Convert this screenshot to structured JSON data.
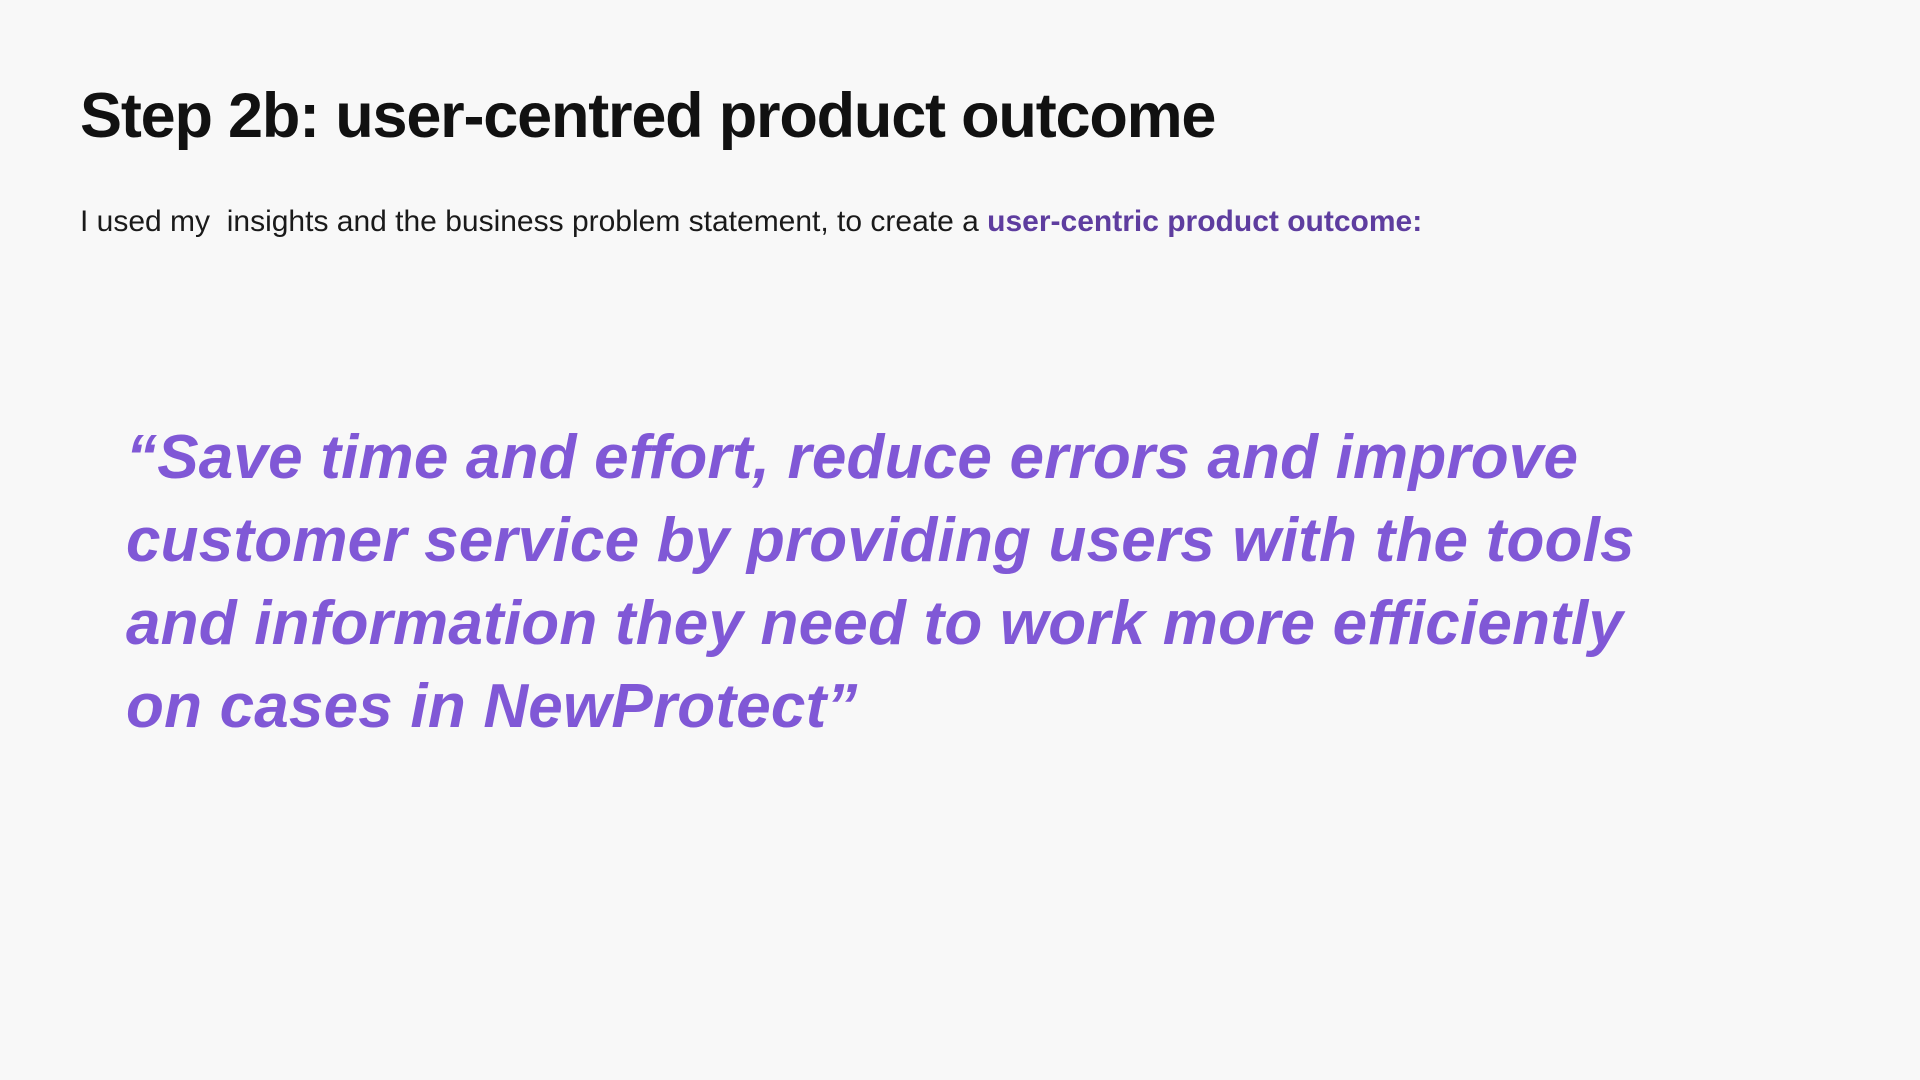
{
  "slide": {
    "title": "Step 2b: user-centred product outcome",
    "intro": {
      "text": "I used my  insights and the business problem statement, to create a ",
      "highlight": "user-centric product outcome:"
    },
    "quote": {
      "lines": [
        "“Save time and effort, reduce errors and improve",
        "customer service by providing users with the tools",
        "and information they need to work more efficiently",
        "on cases in NewProtect”"
      ]
    }
  },
  "colors": {
    "background": "#f8f8f8",
    "title": "#111111",
    "highlight": "#5e3d9f",
    "quote": "#8058d6"
  }
}
